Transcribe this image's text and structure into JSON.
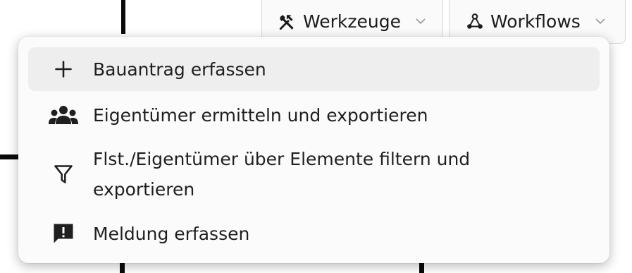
{
  "toolbar": {
    "werkzeuge": {
      "label": "Werkzeuge",
      "icon": "tools-icon"
    },
    "workflows": {
      "label": "Workflows",
      "icon": "workflow-icon"
    }
  },
  "menu": {
    "items": [
      {
        "label": "Bauantrag erfassen",
        "icon": "plus-icon",
        "highlighted": true
      },
      {
        "label": "Eigentümer ermitteln und exportieren",
        "icon": "people-icon"
      },
      {
        "label": "Flst./Eigentümer über Elemente filtern und exportieren",
        "icon": "filter-icon"
      },
      {
        "label": "Meldung erfassen",
        "icon": "report-icon"
      }
    ]
  },
  "colors": {
    "menu_background": "#fbfbfb",
    "highlight": "#eeeeee",
    "text": "#1f1f1f"
  }
}
